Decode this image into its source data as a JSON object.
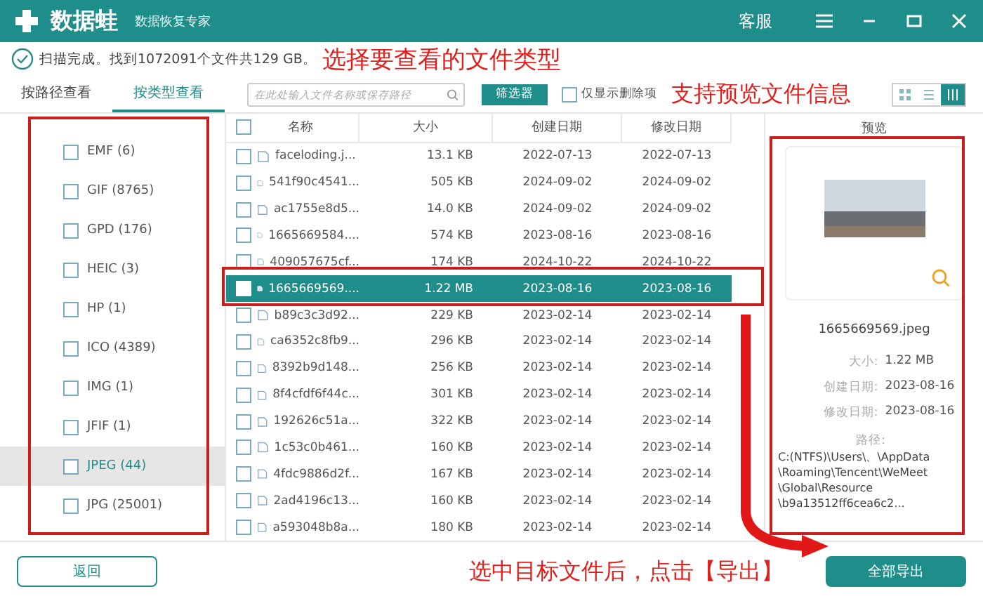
{
  "window": {
    "logo": "数据蛙",
    "subtitle": "数据恢复专家",
    "service": "客服"
  },
  "status": {
    "text": "扫描完成。找到1072091个文件共129 GB。",
    "annotation": "选择要查看的文件类型"
  },
  "tabs": [
    {
      "label": "按路径查看",
      "selected": false
    },
    {
      "label": "按类型查看",
      "selected": true
    }
  ],
  "toolbar": {
    "search_placeholder": "在此处输入文件名称或保存路径",
    "filter_button": "筛选器",
    "deleted_only": {
      "label": "仅显示删除项",
      "checked": false
    },
    "annotation": "支持预览文件信息"
  },
  "view_modes": [
    {
      "kind": "grid",
      "selected": false
    },
    {
      "kind": "list",
      "selected": false
    },
    {
      "kind": "detail",
      "selected": true
    }
  ],
  "types": [
    {
      "label": "EMF (6)",
      "checked": false,
      "selected": false
    },
    {
      "label": "GIF (8765)",
      "checked": false,
      "selected": false
    },
    {
      "label": "GPD (176)",
      "checked": false,
      "selected": false
    },
    {
      "label": "HEIC (3)",
      "checked": false,
      "selected": false
    },
    {
      "label": "HP (1)",
      "checked": false,
      "selected": false
    },
    {
      "label": "ICO (4389)",
      "checked": false,
      "selected": false
    },
    {
      "label": "IMG (1)",
      "checked": false,
      "selected": false
    },
    {
      "label": "JFIF (1)",
      "checked": false,
      "selected": false
    },
    {
      "label": "JPEG (44)",
      "checked": false,
      "selected": true
    },
    {
      "label": "JPG (25001)",
      "checked": false,
      "selected": false
    }
  ],
  "table": {
    "select_all": {
      "checked": false
    },
    "columns": [
      "名称",
      "大小",
      "创建日期",
      "修改日期"
    ],
    "rows": [
      {
        "name": "faceloding.j...",
        "size": "13.1 KB",
        "created": "2022-07-13",
        "modified": "2022-07-13",
        "selected": false
      },
      {
        "name": "541f90c4541...",
        "size": "505 KB",
        "created": "2024-09-02",
        "modified": "2024-09-02",
        "selected": false
      },
      {
        "name": "ac1755e8d5...",
        "size": "14.0 KB",
        "created": "2024-09-02",
        "modified": "2024-09-02",
        "selected": false
      },
      {
        "name": "1665669584....",
        "size": "574 KB",
        "created": "2023-08-16",
        "modified": "2023-08-16",
        "selected": false
      },
      {
        "name": "409057675cf...",
        "size": "174 KB",
        "created": "2024-10-22",
        "modified": "2024-10-22",
        "selected": false
      },
      {
        "name": "1665669569....",
        "size": "1.22 MB",
        "created": "2023-08-16",
        "modified": "2023-08-16",
        "selected": true
      },
      {
        "name": "b89c3c3d92...",
        "size": "229 KB",
        "created": "2023-02-14",
        "modified": "2023-02-14",
        "selected": false
      },
      {
        "name": "ca6352c8fb9...",
        "size": "296 KB",
        "created": "2023-02-14",
        "modified": "2023-02-14",
        "selected": false
      },
      {
        "name": "8392b9d148...",
        "size": "256 KB",
        "created": "2023-02-14",
        "modified": "2023-02-14",
        "selected": false
      },
      {
        "name": "8f4cfdf6f44c...",
        "size": "301 KB",
        "created": "2023-02-14",
        "modified": "2023-02-14",
        "selected": false
      },
      {
        "name": "192626c51a...",
        "size": "322 KB",
        "created": "2023-02-14",
        "modified": "2023-02-14",
        "selected": false
      },
      {
        "name": "1c53c0b461...",
        "size": "160 KB",
        "created": "2023-02-14",
        "modified": "2023-02-14",
        "selected": false
      },
      {
        "name": "4fdc9886d2f...",
        "size": "167 KB",
        "created": "2023-02-14",
        "modified": "2023-02-14",
        "selected": false
      },
      {
        "name": "2ad4196c13...",
        "size": "160 KB",
        "created": "2023-02-14",
        "modified": "2023-02-14",
        "selected": false
      },
      {
        "name": "a593048b8a...",
        "size": "180 KB",
        "created": "2023-02-14",
        "modified": "2023-02-14",
        "selected": false
      }
    ]
  },
  "preview": {
    "title": "预览",
    "filename": "1665669569.jpeg",
    "fields": [
      {
        "label": "大小:",
        "value": "1.22 MB"
      },
      {
        "label": "创建日期:",
        "value": "2023-08-16"
      },
      {
        "label": "修改日期:",
        "value": "2023-08-16"
      }
    ],
    "path_label": "路径:",
    "path_lines": [
      "C:(NTFS)\\Users\\、\\AppData",
      "\\Roaming\\Tencent\\WeMeet",
      "\\Global\\Resource",
      "\\b9a13512ff6cea6c2..."
    ]
  },
  "footer": {
    "back_button": "返回",
    "annotation": "选中目标文件后，点击【导出】",
    "export_button": "全部导出"
  }
}
